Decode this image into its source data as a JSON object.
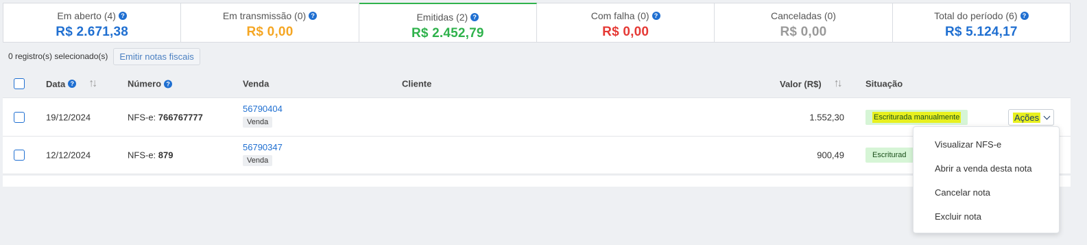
{
  "summary": [
    {
      "label": "Em aberto (4)",
      "value": "R$ 2.671,38",
      "color": "#1f6fd1",
      "help": true,
      "active": false
    },
    {
      "label": "Em transmissão (0)",
      "value": "R$ 0,00",
      "color": "#f5a623",
      "help": true,
      "active": false
    },
    {
      "label": "Emitidas (2)",
      "value": "R$ 2.452,79",
      "color": "#2fb24c",
      "help": true,
      "active": true
    },
    {
      "label": "Com falha (0)",
      "value": "R$ 0,00",
      "color": "#e53935",
      "help": true,
      "active": false
    },
    {
      "label": "Canceladas (0)",
      "value": "R$ 0,00",
      "color": "#9a9a9a",
      "help": false,
      "active": false
    },
    {
      "label": "Total do período (6)",
      "value": "R$ 5.124,17",
      "color": "#1f6fd1",
      "help": true,
      "active": false
    }
  ],
  "toolbar": {
    "selected_text": "0 registro(s) selecionado(s)",
    "emit_label": "Emitir notas fiscais"
  },
  "table": {
    "headers": {
      "data": "Data",
      "numero": "Número",
      "venda": "Venda",
      "cliente": "Cliente",
      "valor": "Valor (R$)",
      "situacao": "Situação"
    },
    "rows": [
      {
        "data": "19/12/2024",
        "numero_prefix": "NFS-e: ",
        "numero": "766767777",
        "venda": "56790404",
        "venda_tag": "Venda",
        "cliente": "",
        "valor": "1.552,30",
        "situacao": "Escriturada manualmente"
      },
      {
        "data": "12/12/2024",
        "numero_prefix": "NFS-e: ",
        "numero": "879",
        "venda": "56790347",
        "venda_tag": "Venda",
        "cliente": "",
        "valor": "900,49",
        "situacao": "Escriturad"
      }
    ],
    "actions_label": "Ações"
  },
  "menu": {
    "items": [
      "Visualizar NFS-e",
      "Abrir a venda desta nota",
      "Cancelar nota",
      "Excluir nota"
    ]
  },
  "help_glyph": "?"
}
